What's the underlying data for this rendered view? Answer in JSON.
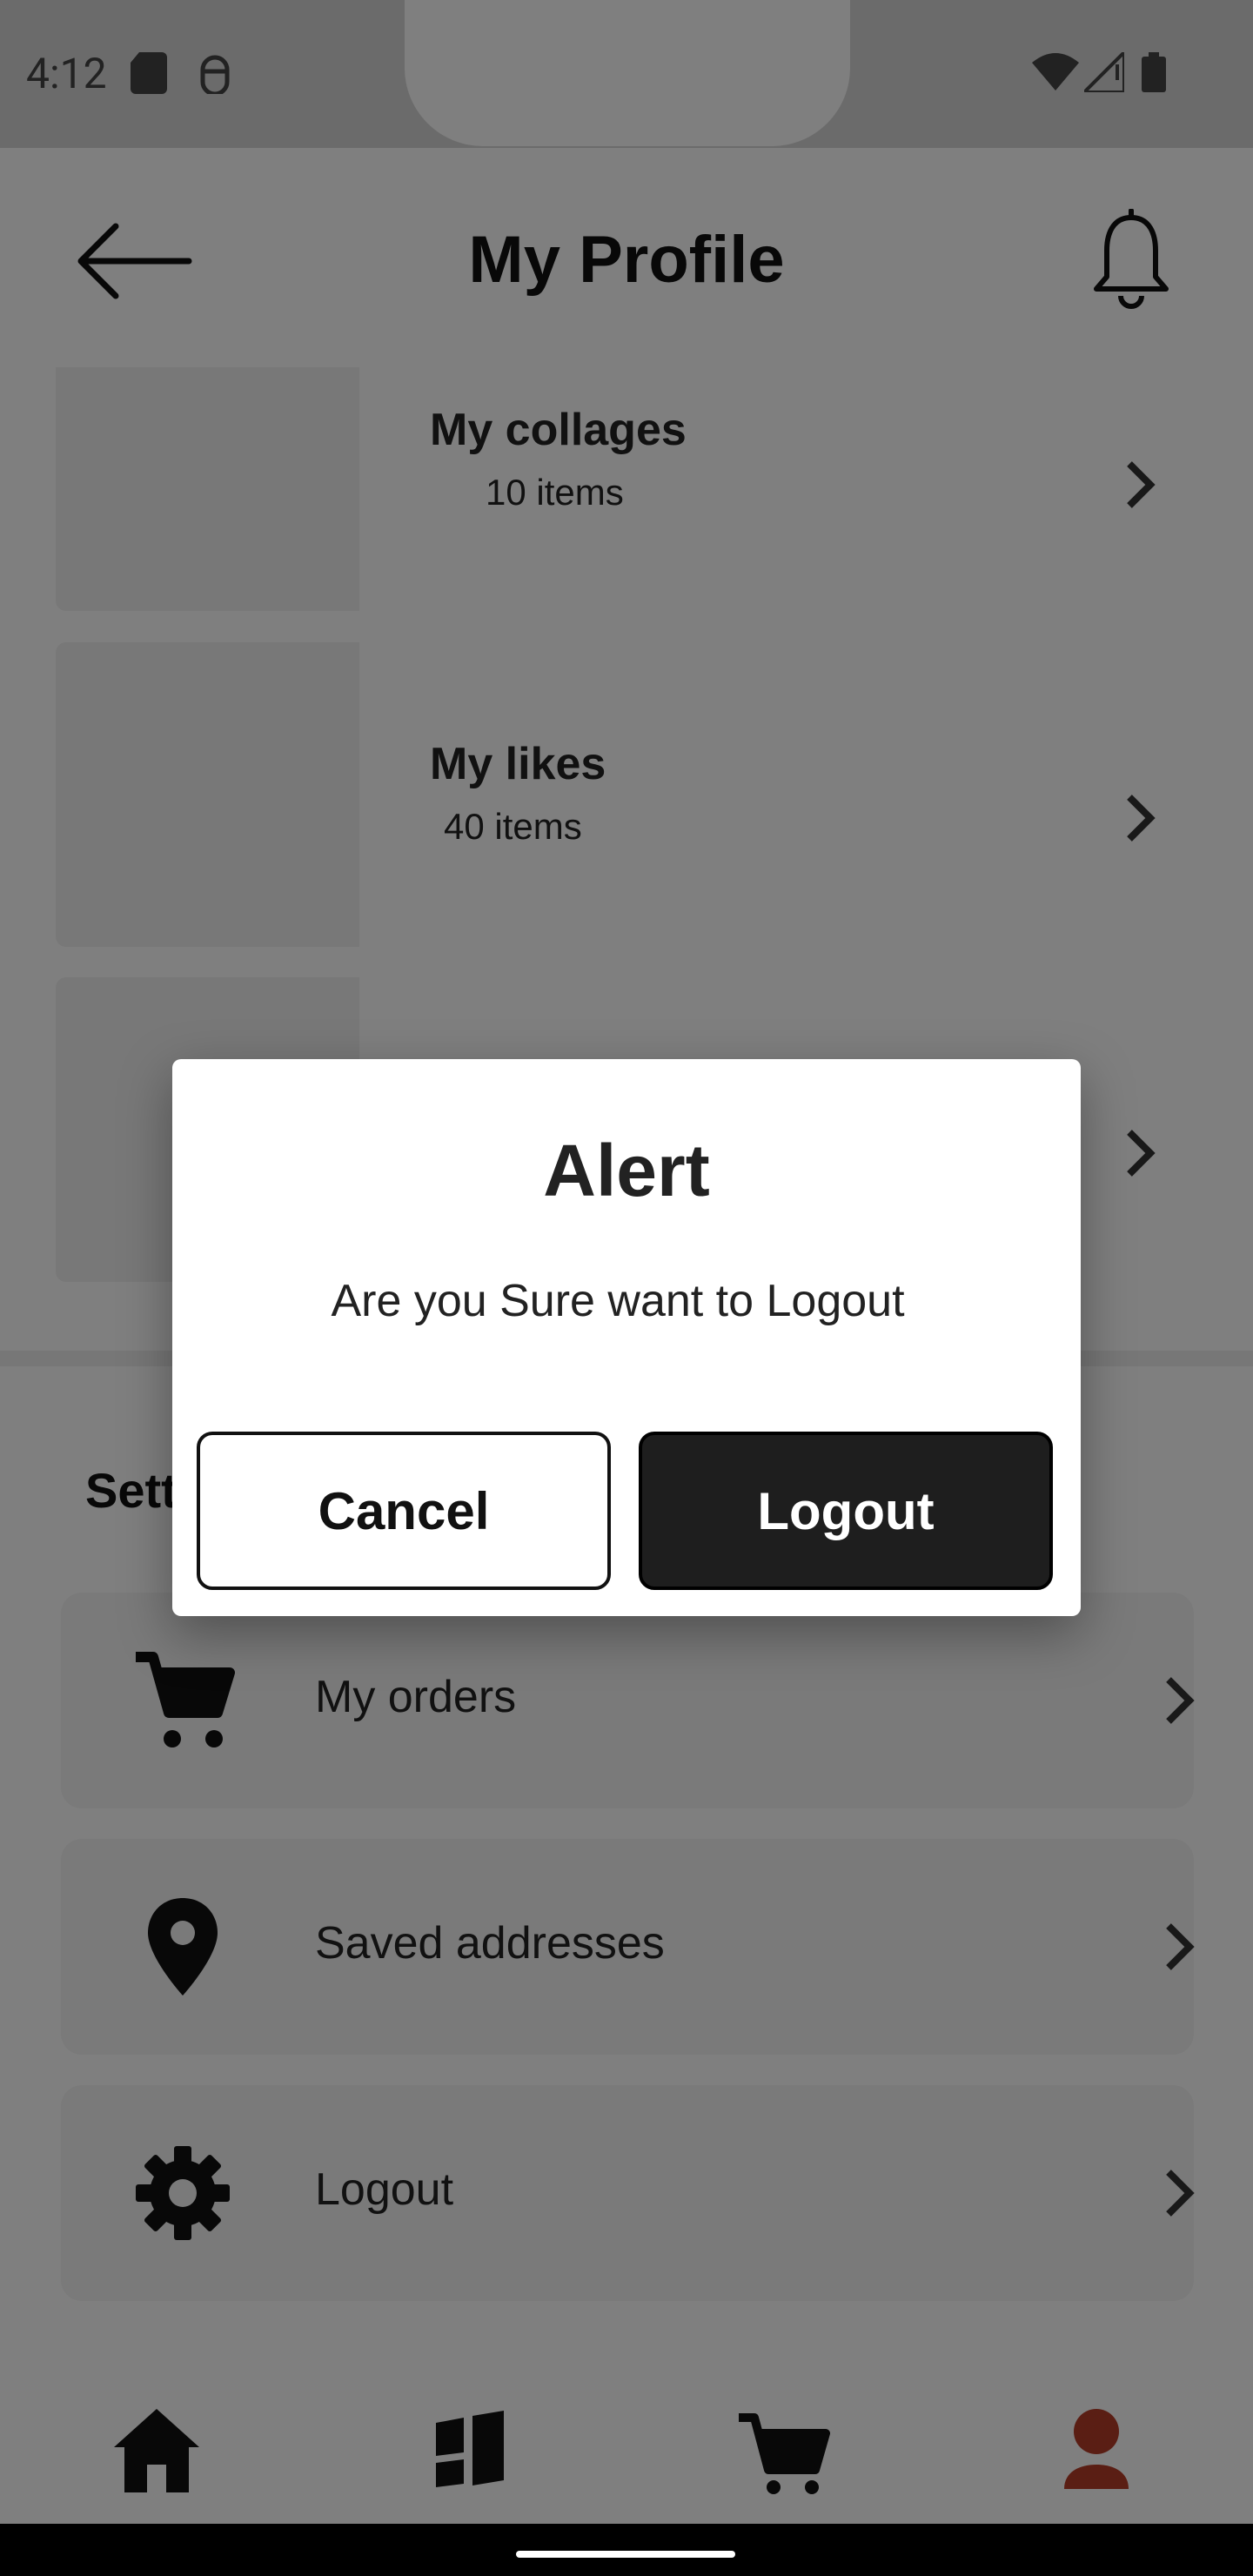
{
  "status_bar": {
    "time": "4:12",
    "icons": [
      "sd-card-icon",
      "android-debug-icon",
      "wifi-icon",
      "signal-icon",
      "battery-icon"
    ]
  },
  "header": {
    "title": "My Profile",
    "back_icon": "arrow-left-icon",
    "notification_icon": "bell-icon"
  },
  "profile_items": [
    {
      "title": "My collages",
      "subtitle": "10 items"
    },
    {
      "title": "My likes",
      "subtitle": "40 items"
    },
    {
      "title": "",
      "subtitle": ""
    }
  ],
  "settings": {
    "heading": "Settings",
    "items": [
      {
        "label": "My orders",
        "icon": "cart-icon"
      },
      {
        "label": "Saved addresses",
        "icon": "location-pin-icon"
      },
      {
        "label": "Logout",
        "icon": "gear-icon"
      }
    ]
  },
  "bottom_nav": [
    {
      "name": "home",
      "icon": "home-icon",
      "active": false
    },
    {
      "name": "collages",
      "icon": "collage-icon",
      "active": false
    },
    {
      "name": "cart",
      "icon": "cart-icon",
      "active": false
    },
    {
      "name": "profile",
      "icon": "profile-icon",
      "active": true
    }
  ],
  "dialog": {
    "title": "Alert",
    "message": "Are you Sure want to Logout",
    "cancel_label": "Cancel",
    "confirm_label": "Logout"
  },
  "colors": {
    "accent_active": "#b43c28",
    "dialog_confirm_bg": "#1e1e1e",
    "scrim": "rgba(0,0,0,0.5)"
  }
}
